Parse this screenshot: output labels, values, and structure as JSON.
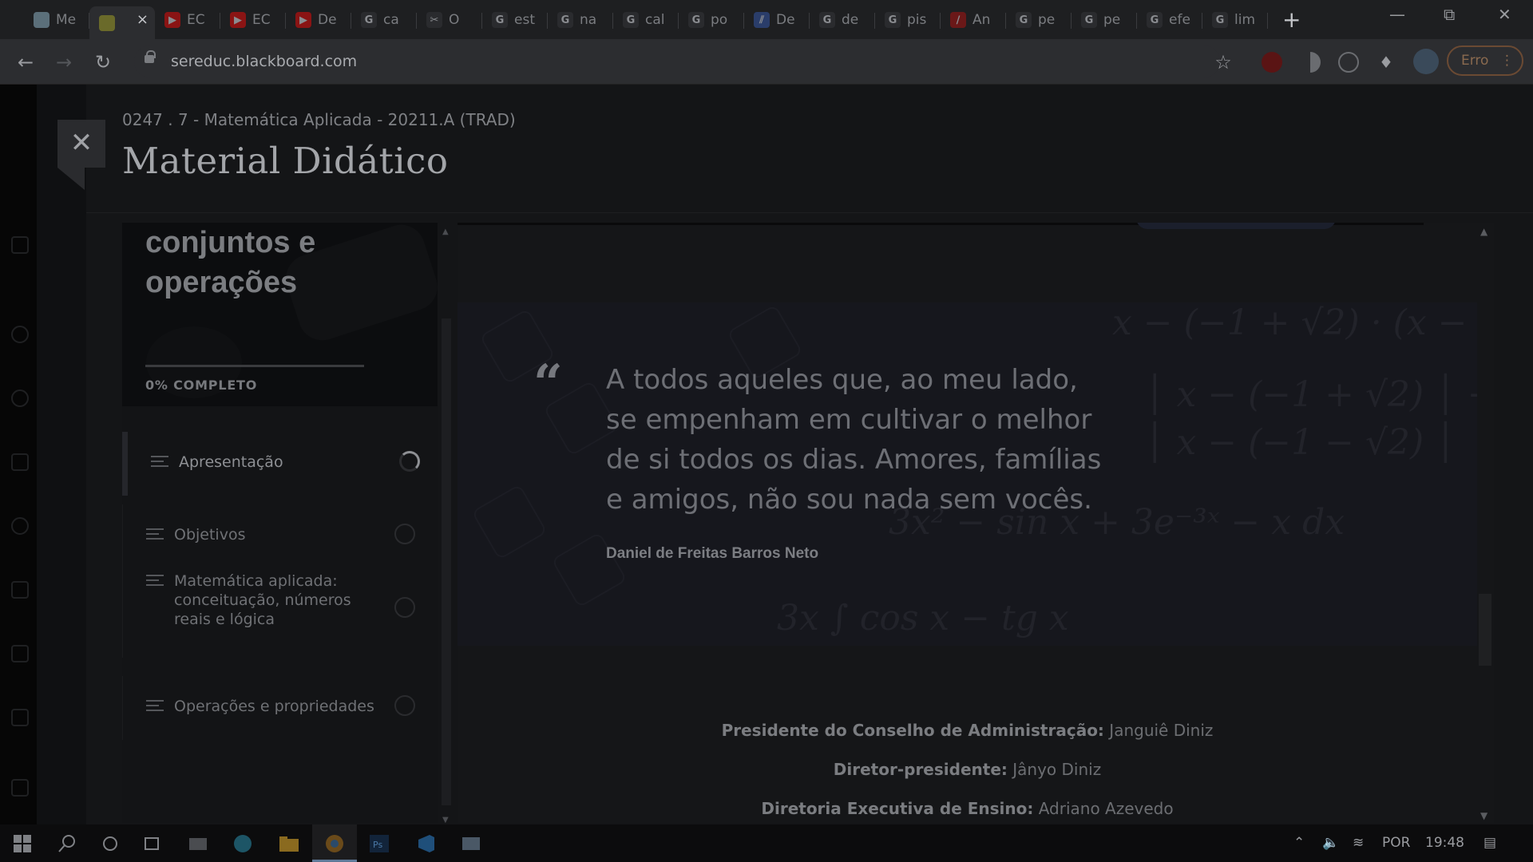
{
  "browser": {
    "tabs": [
      {
        "title": "Me",
        "favicon_color": "#5b6f7a",
        "glyph": ""
      },
      {
        "title": "",
        "favicon_color": "#6a6a2a",
        "glyph": ""
      },
      {
        "title": "EC",
        "favicon_color": "#8a1414",
        "glyph": "▶"
      },
      {
        "title": "EC",
        "favicon_color": "#8a1414",
        "glyph": "▶"
      },
      {
        "title": "De",
        "favicon_color": "#8a1414",
        "glyph": "▶"
      },
      {
        "title": "ca",
        "favicon_color": "#2a2b2e",
        "glyph": "G"
      },
      {
        "title": "O",
        "favicon_color": "#2a2b2e",
        "glyph": "✂"
      },
      {
        "title": "est",
        "favicon_color": "#2a2b2e",
        "glyph": "G"
      },
      {
        "title": "na",
        "favicon_color": "#2a2b2e",
        "glyph": "G"
      },
      {
        "title": "cal",
        "favicon_color": "#2a2b2e",
        "glyph": "G"
      },
      {
        "title": "po",
        "favicon_color": "#2a2b2e",
        "glyph": "G"
      },
      {
        "title": "De",
        "favicon_color": "#2a3d6a",
        "glyph": "⫽"
      },
      {
        "title": "de",
        "favicon_color": "#2a2b2e",
        "glyph": "G"
      },
      {
        "title": "pis",
        "favicon_color": "#2a2b2e",
        "glyph": "G"
      },
      {
        "title": "An",
        "favicon_color": "#6a1818",
        "glyph": "∕"
      },
      {
        "title": "pe",
        "favicon_color": "#2a2b2e",
        "glyph": "G"
      },
      {
        "title": "pe",
        "favicon_color": "#2a2b2e",
        "glyph": "G"
      },
      {
        "title": "efe",
        "favicon_color": "#2a2b2e",
        "glyph": "G"
      },
      {
        "title": "lim",
        "favicon_color": "#2a2b2e",
        "glyph": "G"
      }
    ],
    "active_tab_index": 1,
    "new_tab": "+",
    "url": "sereduc.blackboard.com",
    "profile_status": "Erro"
  },
  "course": {
    "id_line": "0247 . 7 - Matemática Aplicada - 20211.A (TRAD)",
    "title": "Material Didático"
  },
  "module": {
    "cover_title": "conjuntos e operações",
    "progress_percent": 0,
    "progress_label": "0% COMPLETO",
    "items": [
      {
        "label": "Apresentação",
        "status": "loading",
        "current": true
      },
      {
        "label": "Objetivos",
        "status": "empty",
        "current": false
      },
      {
        "label": "Matemática aplicada: conceituação, números reais e lógica",
        "status": "empty",
        "current": false
      },
      {
        "label": "Operações e propriedades",
        "status": "empty",
        "current": false
      }
    ]
  },
  "quote": {
    "mark": "“",
    "text": "A todos aqueles que, ao meu lado, se empenham em cultivar o melhor de si todos os dias. Amores, famílias e amigos, não sou nada sem vocês.",
    "author": "Daniel de Freitas Barros Neto"
  },
  "credits": [
    {
      "role": "Presidente do Conselho de Administração:",
      "name": "Janguiê Diniz"
    },
    {
      "role": "Diretor-presidente:",
      "name": "Jânyo Diniz"
    },
    {
      "role": "Diretoria Executiva de Ensino:",
      "name": "Adriano Azevedo"
    }
  ],
  "taskbar": {
    "language": "POR",
    "time": "19:48"
  }
}
